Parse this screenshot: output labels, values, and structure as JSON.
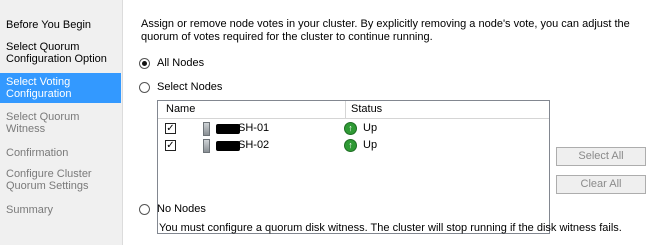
{
  "nav": {
    "items": [
      {
        "label": "Before You Begin",
        "state": "normal"
      },
      {
        "label": "Select Quorum Configuration Option",
        "state": "normal"
      },
      {
        "label": "Select Voting Configuration",
        "state": "selected"
      },
      {
        "label": "Select Quorum Witness",
        "state": "disabled"
      },
      {
        "label": "Confirmation",
        "state": "disabled"
      },
      {
        "label": "Configure Cluster Quorum Settings",
        "state": "disabled"
      },
      {
        "label": "Summary",
        "state": "disabled"
      }
    ]
  },
  "main": {
    "description": "Assign or remove node votes in your cluster. By explicitly removing a node's vote, you can adjust the quorum of votes required for the cluster to continue running.",
    "options": {
      "all_nodes": "All Nodes",
      "select_nodes": "Select Nodes",
      "no_nodes": "No Nodes"
    },
    "selected_option": "all_nodes",
    "list": {
      "columns": [
        "Name",
        "Status"
      ],
      "rows": [
        {
          "name": "SH-01",
          "status": "Up",
          "checked": true
        },
        {
          "name": "SH-02",
          "status": "Up",
          "checked": true
        }
      ]
    },
    "buttons": {
      "select_all": "Select All",
      "clear_all": "Clear All"
    },
    "footnote": "You must configure a quorum disk witness. The cluster will stop running if the disk witness fails."
  },
  "colors": {
    "selected_nav_bg": "#3399ff",
    "status_up": "#2f9a35"
  }
}
